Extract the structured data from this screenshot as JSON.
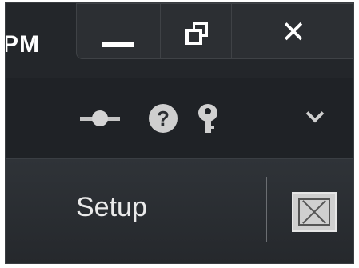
{
  "titlebar": {
    "clock_fragment": "PM",
    "minimize_icon": "minimize-icon",
    "restore_icon": "restore-icon",
    "close_label": "✕"
  },
  "toolbar": {
    "icons": [
      "network-status-icon",
      "help-icon",
      "key-icon",
      "chevron-down-icon"
    ],
    "help_glyph": "?"
  },
  "nav": {
    "setup_label": "Setup",
    "fullscreen_icon": "fullscreen-icon"
  },
  "colors": {
    "titlebar_bg": "#23262a",
    "toolbar_bg": "#1f2226",
    "nav_bg": "#2f3338",
    "icon_gray": "#cfcfcf",
    "text": "#ffffff"
  }
}
